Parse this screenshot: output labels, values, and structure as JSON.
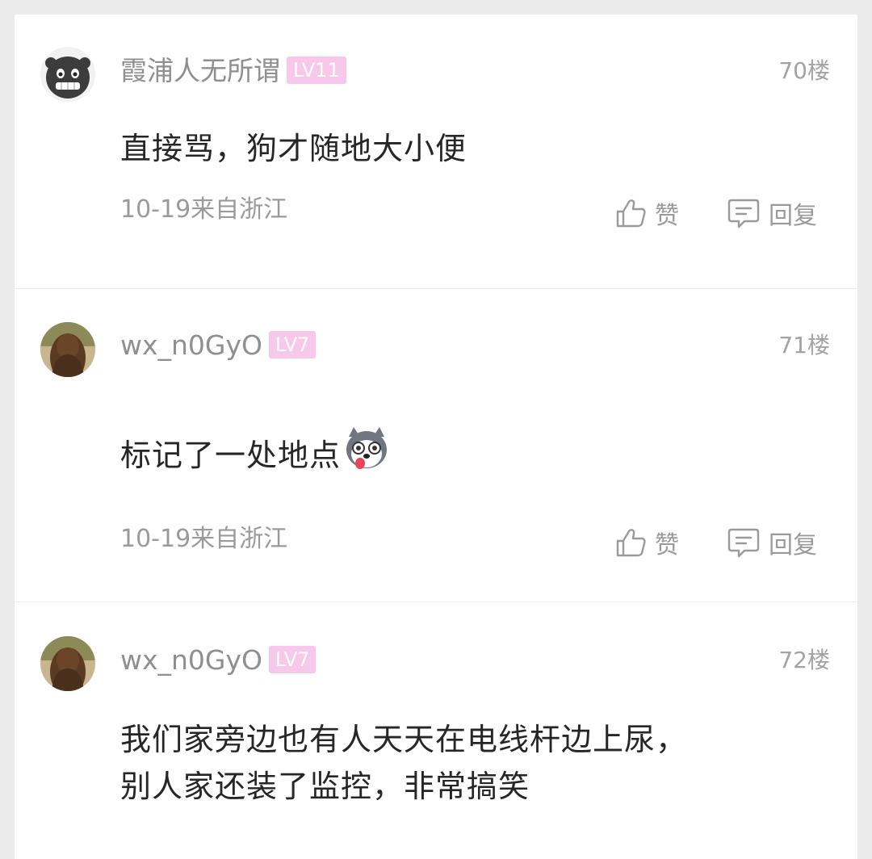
{
  "comments": [
    {
      "username": "霞浦人无所谓",
      "level": "LV11",
      "floor": "70楼",
      "text": "直接骂，狗才随地大小便",
      "meta": "10-19来自浙江",
      "like_label": "赞",
      "reply_label": "回复",
      "avatar": "cartoon-grin-avatar"
    },
    {
      "username": "wx_n0GyO",
      "level": "LV7",
      "floor": "71楼",
      "text": "标记了一处地点",
      "emoji": "husky-face-emoji",
      "meta": "10-19来自浙江",
      "like_label": "赞",
      "reply_label": "回复",
      "avatar": "long-hair-photo-avatar"
    },
    {
      "username": "wx_n0GyO",
      "level": "LV7",
      "floor": "72楼",
      "text_line1": "我们家旁边也有人天天在电线杆边上尿，",
      "text_line2": "别人家还装了监控，非常搞笑",
      "avatar": "long-hair-photo-avatar"
    }
  ],
  "colors": {
    "badge": "#f7c8ea",
    "username": "#8f8f8f",
    "text": "#262626",
    "meta": "#9a9a9a"
  }
}
